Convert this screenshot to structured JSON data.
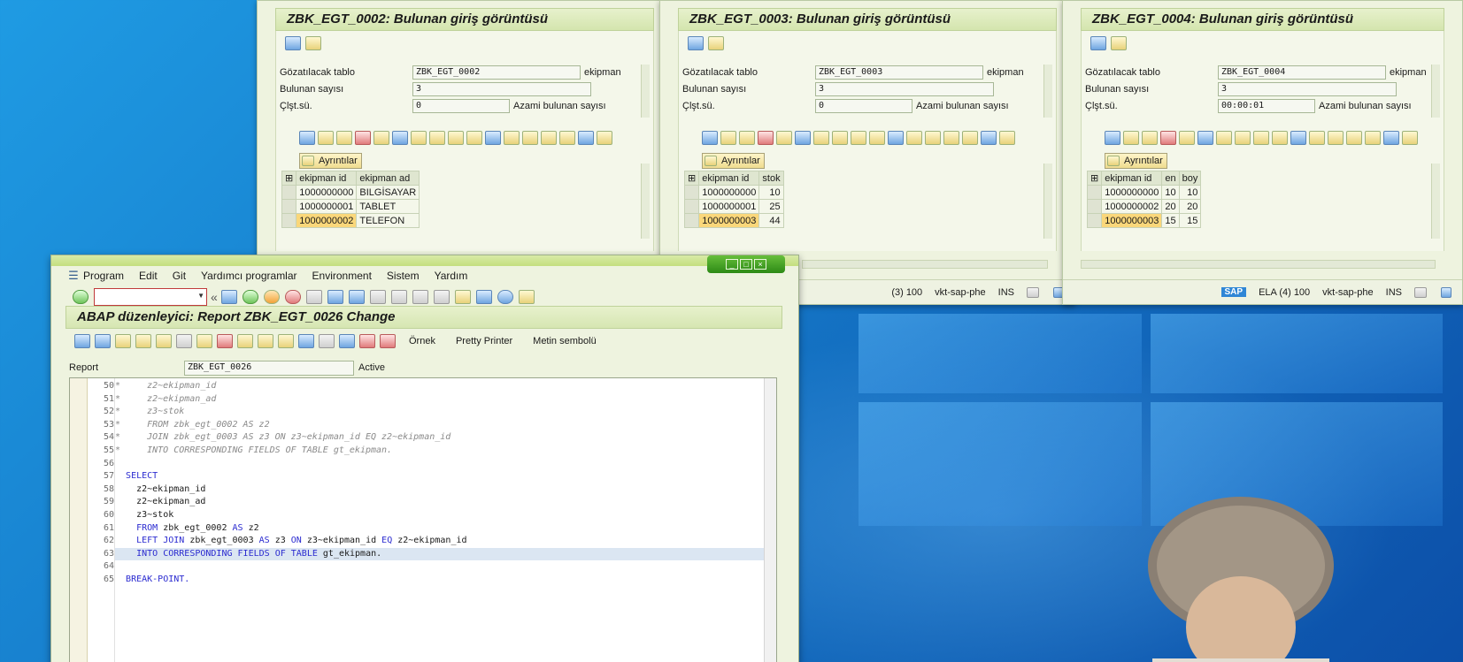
{
  "result_windows": [
    {
      "title": "ZBK_EGT_0002: Bulunan giriş görüntüsü",
      "table_label": "Gözatılacak tablo",
      "table_value": "ZBK_EGT_0002",
      "table_suffix": "ekipman",
      "count_label": "Bulunan sayısı",
      "count_value": "3",
      "runtime_label": "Çlşt.sü.",
      "runtime_value": "0",
      "max_label": "Azami bulunan sayısı",
      "details_label": "Ayrıntılar",
      "columns": [
        "ekipman id",
        "ekipman ad"
      ],
      "rows": [
        [
          "1000000000",
          "BILGİSAYAR"
        ],
        [
          "1000000001",
          "TABLET"
        ],
        [
          "1000000002",
          "TELEFON"
        ]
      ],
      "status": {
        "client": "",
        "server": "",
        "mode": ""
      }
    },
    {
      "title": "ZBK_EGT_0003: Bulunan giriş görüntüsü",
      "table_label": "Gözatılacak tablo",
      "table_value": "ZBK_EGT_0003",
      "table_suffix": "ekipman",
      "count_label": "Bulunan sayısı",
      "count_value": "3",
      "runtime_label": "Çlşt.sü.",
      "runtime_value": "0",
      "max_label": "Azami bulunan sayısı",
      "details_label": "Ayrıntılar",
      "columns": [
        "ekipman id",
        "stok"
      ],
      "rows": [
        [
          "1000000000",
          "10"
        ],
        [
          "1000000001",
          "25"
        ],
        [
          "1000000003",
          "44"
        ]
      ],
      "status": {
        "client": "(3) 100",
        "server": "vkt-sap-phe",
        "mode": "INS"
      }
    },
    {
      "title": "ZBK_EGT_0004: Bulunan giriş görüntüsü",
      "table_label": "Gözatılacak tablo",
      "table_value": "ZBK_EGT_0004",
      "table_suffix": "ekipman",
      "count_label": "Bulunan sayısı",
      "count_value": "3",
      "runtime_label": "Çlşt.sü.",
      "runtime_value": "00:00:01",
      "max_label": "Azami bulunan sayısı",
      "details_label": "Ayrıntılar",
      "columns": [
        "ekipman id",
        "en",
        "boy"
      ],
      "rows": [
        [
          "1000000000",
          "10",
          "10"
        ],
        [
          "1000000002",
          "20",
          "20"
        ],
        [
          "1000000003",
          "15",
          "15"
        ]
      ],
      "status": {
        "client": "ELA (4) 100",
        "server": "vkt-sap-phe",
        "mode": "INS",
        "logo": "SAP"
      }
    }
  ],
  "editor_window": {
    "menu": [
      "Program",
      "Edit",
      "Git",
      "Yardımcı programlar",
      "Environment",
      "Sistem",
      "Yardım"
    ],
    "title": "ABAP düzenleyici: Report ZBK_EGT_0026 Change",
    "toolbar_text_buttons": [
      "Örnek",
      "Pretty Printer",
      "Metin sembolü"
    ],
    "report_label": "Report",
    "report_value": "ZBK_EGT_0026",
    "report_status": "Active",
    "code_lines": [
      {
        "n": "50",
        "text": "*     z2~ekipman_id",
        "type": "comment"
      },
      {
        "n": "51",
        "text": "*     z2~ekipman_ad",
        "type": "comment"
      },
      {
        "n": "52",
        "text": "*     z3~stok",
        "type": "comment"
      },
      {
        "n": "53",
        "text": "*     FROM zbk_egt_0002 AS z2",
        "type": "comment"
      },
      {
        "n": "54",
        "text": "*     JOIN zbk_egt_0003 AS z3 ON z3~ekipman_id EQ z2~ekipman_id",
        "type": "comment"
      },
      {
        "n": "55",
        "text": "*     INTO CORRESPONDING FIELDS OF TABLE gt_ekipman.",
        "type": "comment"
      },
      {
        "n": "56",
        "text": "",
        "type": "plain"
      },
      {
        "n": "57",
        "text": "  SELECT",
        "type": "keyword"
      },
      {
        "n": "58",
        "text": "    z2~ekipman_id",
        "type": "plain"
      },
      {
        "n": "59",
        "text": "    z2~ekipman_ad",
        "type": "plain"
      },
      {
        "n": "60",
        "text": "    z3~stok",
        "type": "plain"
      },
      {
        "n": "61",
        "text": "    FROM zbk_egt_0002 AS z2",
        "type": "mixed"
      },
      {
        "n": "62",
        "text": "    LEFT JOIN zbk_egt_0003 AS z3 ON z3~ekipman_id EQ z2~ekipman_id",
        "type": "mixed"
      },
      {
        "n": "63",
        "text": "    INTO CORRESPONDING FIELDS OF TABLE gt_ekipman.",
        "type": "mixed"
      },
      {
        "n": "64",
        "text": "",
        "type": "plain"
      },
      {
        "n": "65",
        "text": "  BREAK-POINT.",
        "type": "keyword"
      }
    ]
  },
  "colors": {
    "sap_bg": "#eef3df",
    "title_bg": "#d6e6b2",
    "highlight_cell": "#fad77a",
    "keyword": "#2b2bd0",
    "comment": "#8a8a8a",
    "desktop_blue": "#1578c8"
  }
}
